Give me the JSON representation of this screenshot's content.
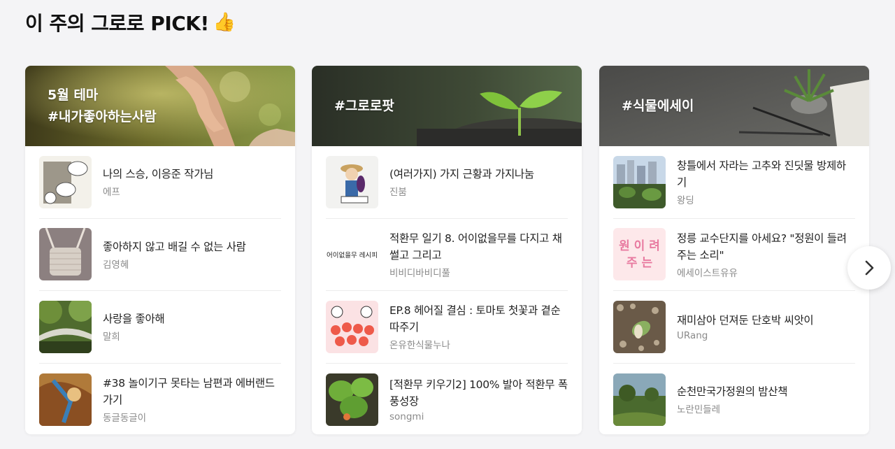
{
  "heading": {
    "title": "이 주의 그로로 PICK!",
    "emoji": "👍"
  },
  "cards": [
    {
      "banner_lines": [
        "5월 테마",
        "#내가좋아하는사람"
      ],
      "items": [
        {
          "title": "나의 스승, 이응준 작가님",
          "author": "에프"
        },
        {
          "title": "좋아하지 않고 배길 수 없는 사람",
          "author": "김영혜"
        },
        {
          "title": "사랑을 좋아해",
          "author": "말희"
        },
        {
          "title": "#38 놀이기구 못타는 남편과 에버랜드 가기",
          "author": "동글동글이"
        }
      ]
    },
    {
      "banner_lines": [
        "#그로로팟"
      ],
      "items": [
        {
          "title": "(여러가지) 가지 근황과 가지나눔",
          "author": "진붐"
        },
        {
          "title": "적환무 일기 8. 어이없을무를 다지고 채썰고 그리고",
          "author": "비비디바비디풀",
          "thumb_text": "어이없을무 레시피"
        },
        {
          "title": "EP.8 헤어질 결심 : 토마토 첫꽃과 곁순 따주기",
          "author": "온유한식물누나"
        },
        {
          "title": "[적환무 키우기2] 100% 발아 적환무 폭풍성장",
          "author": "songmi"
        }
      ]
    },
    {
      "banner_lines": [
        "#식물에세이"
      ],
      "items": [
        {
          "title": "창틀에서 자라는 고추와 진딧물 방제하기",
          "author": "왕딩"
        },
        {
          "title": "정릉 교수단지를 아세요? \"정원이 들려주는 소리\"",
          "author": "에세이스트유유",
          "thumb_text": "원 이 려 주 는"
        },
        {
          "title": "재미삼아 던져둔 단호박 씨앗이",
          "author": "URang"
        },
        {
          "title": "순천만국가정원의 밤산책",
          "author": "노란민들레"
        }
      ]
    }
  ],
  "icons": {
    "next": "chevron-right-icon"
  }
}
